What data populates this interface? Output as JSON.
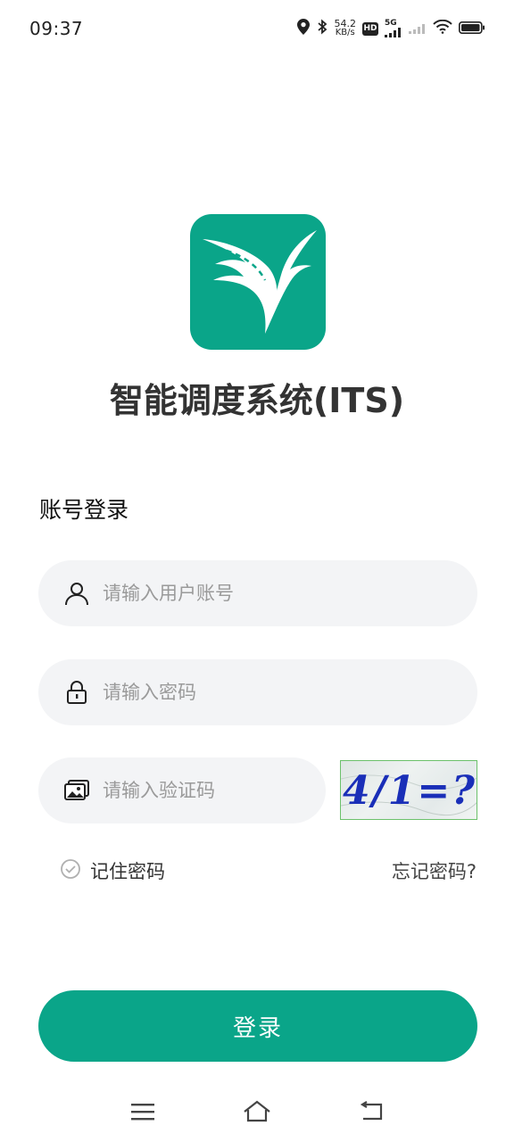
{
  "status_bar": {
    "time": "09:37",
    "net_speed_value": "54.2",
    "net_speed_unit": "KB/s",
    "hd_label": "HD",
    "network_label": "5G",
    "icons": [
      "location-icon",
      "bluetooth-icon",
      "hd-icon",
      "signal-5g-icon",
      "signal-icon",
      "wifi-icon",
      "battery-icon"
    ]
  },
  "app": {
    "title": "智能调度系统(ITS)",
    "brand_color": "#0aa589"
  },
  "login": {
    "section_title": "账号登录",
    "username_placeholder": "请输入用户账号",
    "username_value": "",
    "password_placeholder": "请输入密码",
    "password_value": "",
    "code_placeholder": "请输入验证码",
    "code_value": "",
    "captcha_text": "4/1=?",
    "remember_label": "记住密码",
    "remember_checked": false,
    "forgot_label": "忘记密码?",
    "submit_label": "登录"
  },
  "nav_bar": {
    "icons": [
      "menu-icon",
      "home-icon",
      "back-icon"
    ]
  }
}
